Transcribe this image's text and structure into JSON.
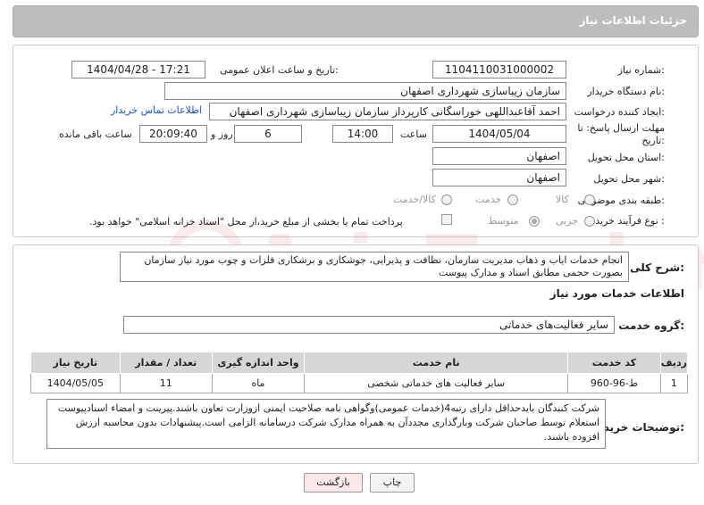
{
  "header": {
    "title": "جزئیات اطلاعات نیاز"
  },
  "form": {
    "need_number_label": "شماره نیاز:",
    "need_number": "1104110031000002",
    "announce_label": "تاریخ و ساعت اعلان عمومی:",
    "announce_value": "1404/04/28 - 17:21",
    "buyer_label": "نام دستگاه خریدار:",
    "buyer_value": "سازمان زیباسازی شهرداری اصفهان",
    "creator_label": "ایجاد کننده درخواست:",
    "creator_value": "احمد آقاعبداللهی خوراسگانی کارپرداز سازمان زیباسازی شهرداری اصفهان",
    "contact_link": "اطلاعات تماس خریدار",
    "deadline_label": "مهلت ارسال پاسخ: تا تاریخ:",
    "deadline_date": "1404/05/04",
    "time_label": "ساعت",
    "deadline_time": "14:00",
    "days_value": "6",
    "days_label": "روز و",
    "remaining_time": "20:09:40",
    "remaining_label": "ساعت باقی مانده",
    "province_label": "استان محل تحویل:",
    "province_value": "اصفهان",
    "city_label": "شهر محل تحویل:",
    "city_value": "اصفهان",
    "category_label": "طبقه بندی موضوعی:",
    "category_options": [
      "کالا",
      "خدمت",
      "کالا/خدمت"
    ],
    "process_label": "نوع فرآیند خرید :",
    "process_options": [
      "جزیی",
      "متوسط"
    ],
    "payment_note": "پرداخت تمام یا بخشی از مبلغ خرید،از محل \"اسناد خزانه اسلامی\" خواهد بود."
  },
  "details": {
    "summary_label": "شرح کلی نیاز:",
    "summary_text": "انجام خدمات ایاب و ذهاب مدیریت سازمان، نظافت و پذیرایی، جوشکاری و برشکاری فلزات و چوب مورد نیاز سازمان بصورت حجمی مطابق اسناد و مدارک پیوست",
    "services_title": "اطلاعات خدمات مورد نیاز",
    "group_label": "گروه خدمت:",
    "group_value": "سایر فعالیت‌های خدماتی",
    "table_headers": [
      "ردیف",
      "کد خدمت",
      "نام خدمت",
      "واحد اندازه گیری",
      "تعداد / مقدار",
      "تاریخ نیاز"
    ],
    "table_rows": [
      [
        "1",
        "ط-96-960",
        "سایر فعالیت های خدماتی شخصی",
        "ماه",
        "11",
        "1404/05/05"
      ]
    ],
    "notes_label": "توضیحات خریدار:",
    "notes_text": "شرکت کنندگان بایدحداقل دارای رتبه4(خدمات عمومی)وگواهی نامه صلاحیت ایمنی ازوزارت تعاون باشند.پیرینت و امضاء اسنادپیوست استعلام توسط صاحبان شرکت وبارگذاری مجددآن به همراه مدارک شرکت درسامانه الزامی است.پیشنهادات بدون محاسبه ارزش افزوده باشند."
  },
  "buttons": {
    "print": "چاپ",
    "back": "بازگشت"
  },
  "watermark_text": "AriaTender.neT"
}
